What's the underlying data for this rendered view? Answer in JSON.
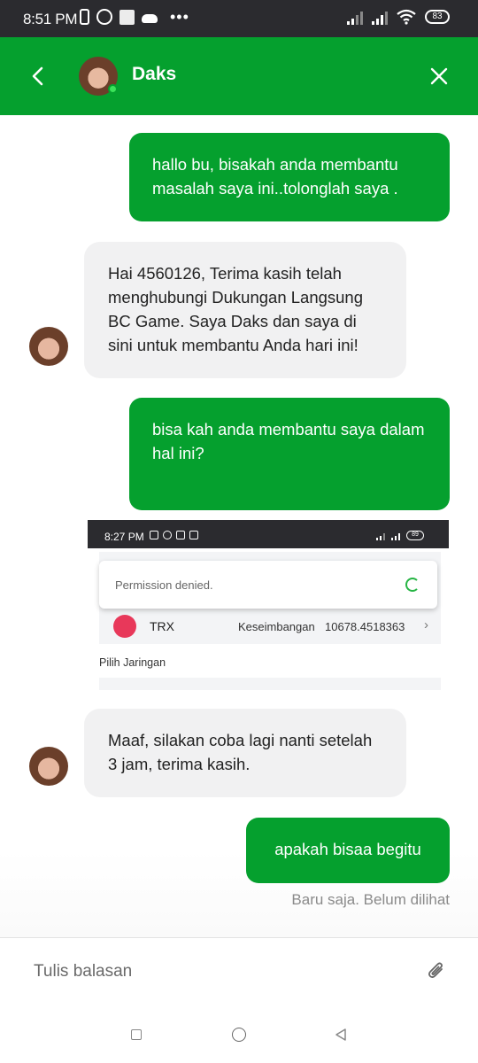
{
  "status_bar": {
    "time": "8:51 PM",
    "battery": "83",
    "icons": [
      "phone-icon",
      "whatsapp-icon",
      "gallery-icon",
      "cloud-icon",
      "more-dots-icon",
      "signal-icon",
      "wifi-icon",
      "battery-icon"
    ]
  },
  "header": {
    "name": "Daks",
    "icons": {
      "back": "chevron-left-icon",
      "close": "close-icon"
    },
    "online_color": "#3be35a"
  },
  "messages": [
    {
      "from": "user",
      "text": "hallo bu, bisakah anda membantu masalah saya ini..tolonglah saya ."
    },
    {
      "from": "agent",
      "text": "Hai 4560126, Terima kasih telah menghubungi Dukungan Langsung BC Game. Saya Daks dan saya di sini untuk membantu Anda hari ini!"
    },
    {
      "from": "user",
      "text": "bisa kah anda membantu saya dalam hal ini?"
    },
    {
      "from": "user",
      "type": "image",
      "screenshot": {
        "time": "8:27 PM",
        "battery": "89",
        "toast": "Permission denied.",
        "coin": "TRX",
        "balance_label": "Keseimbangan",
        "balance_value": "10678.4518363",
        "network_label": "Pilih Jaringan"
      }
    },
    {
      "from": "agent",
      "text": "Maaf, silakan coba lagi nanti setelah 3 jam, terima kasih."
    },
    {
      "from": "user",
      "text": "apakah bisaa begitu"
    }
  ],
  "delivery_status": "Baru saja. Belum dilihat",
  "composer": {
    "placeholder": "Tulis balasan",
    "attach_icon": "paperclip-icon"
  },
  "nav": {
    "icons": [
      "recent-apps-icon",
      "home-icon",
      "back-icon"
    ]
  },
  "colors": {
    "brand_green": "#05a02e",
    "incoming_bubble": "#f1f1f2",
    "status_bar": "#2b2b2f"
  }
}
